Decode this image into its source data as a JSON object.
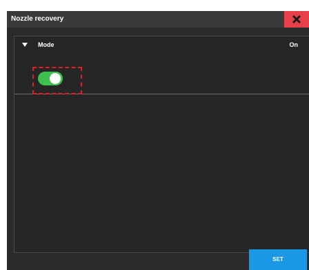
{
  "window": {
    "title": "Nozzle recovery",
    "close_icon": "close-x-icon",
    "accent_color": "#e8414a"
  },
  "section": {
    "label": "Mode",
    "value": "On",
    "expand_icon": "caret-down-icon",
    "toggle": {
      "state": true,
      "on_color": "#3fbf4f"
    },
    "focus_outline_color": "#e31e2b"
  },
  "footer": {
    "set_label": "SET",
    "set_color": "#1a98e6"
  }
}
